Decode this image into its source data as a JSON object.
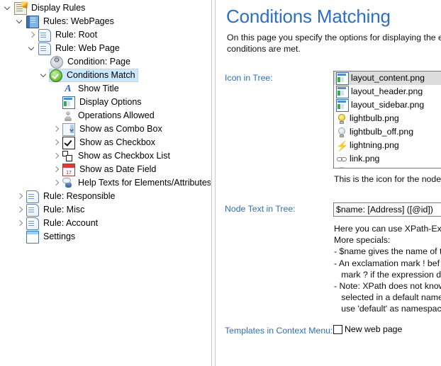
{
  "tree": {
    "items": [
      {
        "label": "Display Rules",
        "depth": 0,
        "expander": "expanded",
        "icon": "document-pencil-icon",
        "icon_class": "ic-displayrules",
        "selected": false
      },
      {
        "label": "Rules: WebPages",
        "depth": 1,
        "expander": "expanded",
        "icon": "book-icon",
        "icon_class": "ic-book",
        "selected": false
      },
      {
        "label": "Rule: Root",
        "depth": 2,
        "expander": "collapsed",
        "icon": "scroll-icon",
        "icon_class": "ic-scroll",
        "selected": false
      },
      {
        "label": "Rule: Web Page",
        "depth": 2,
        "expander": "expanded",
        "icon": "scroll-icon",
        "icon_class": "ic-scroll",
        "selected": false
      },
      {
        "label": "Condition: Page",
        "depth": 3,
        "expander": "none",
        "icon": "condition-gear-icon",
        "icon_class": "ic-condition",
        "selected": false
      },
      {
        "label": "Conditions Match",
        "depth": 3,
        "expander": "expanded",
        "icon": "green-check-circle-icon",
        "icon_class": "ic-check-green",
        "selected": true
      },
      {
        "label": "Show Title",
        "depth": 4,
        "expander": "none",
        "icon": "letter-a-icon",
        "icon_class": "ic-title",
        "selected": false
      },
      {
        "label": "Display Options",
        "depth": 4,
        "expander": "none",
        "icon": "layout-icon",
        "icon_class": "ic-layout",
        "selected": false
      },
      {
        "label": "Operations Allowed",
        "depth": 4,
        "expander": "none",
        "icon": "user-icon",
        "icon_class": "ic-user",
        "selected": false
      },
      {
        "label": "Show as Combo Box",
        "depth": 4,
        "expander": "collapsed",
        "icon": "combobox-icon",
        "icon_class": "ic-combo",
        "selected": false
      },
      {
        "label": "Show as Checkbox",
        "depth": 4,
        "expander": "collapsed",
        "icon": "checkbox-icon",
        "icon_class": "ic-checkbox",
        "selected": false
      },
      {
        "label": "Show as Checkbox List",
        "depth": 4,
        "expander": "collapsed",
        "icon": "checkbox-list-icon",
        "icon_class": "ic-checklist",
        "selected": false
      },
      {
        "label": "Show as Date Field",
        "depth": 4,
        "expander": "collapsed",
        "icon": "calendar-icon",
        "icon_class": "ic-date",
        "selected": false
      },
      {
        "label": "Help Texts for Elements/Attributes",
        "depth": 4,
        "expander": "collapsed",
        "icon": "help-person-icon",
        "icon_class": "ic-help",
        "selected": false
      },
      {
        "label": "Rule: Responsible",
        "depth": 1,
        "expander": "collapsed",
        "icon": "scroll-icon",
        "icon_class": "ic-scroll",
        "selected": false
      },
      {
        "label": "Rule: Misc",
        "depth": 1,
        "expander": "collapsed",
        "icon": "scroll-icon",
        "icon_class": "ic-scroll",
        "selected": false
      },
      {
        "label": "Rule: Account",
        "depth": 1,
        "expander": "collapsed",
        "icon": "scroll-icon",
        "icon_class": "ic-scroll",
        "selected": false
      },
      {
        "label": "Settings",
        "depth": 1,
        "expander": "none",
        "icon": "settings-window-icon",
        "icon_class": "ic-settings",
        "selected": false
      }
    ]
  },
  "panel": {
    "title": "Conditions Matching",
    "description_line1": "On this page you specify the options for displaying the e",
    "description_line2": "conditions are met.",
    "labels": {
      "icon_in_tree": "Icon in Tree:",
      "node_text_in_tree": "Node Text in Tree:",
      "templates_in_context_menu": "Templates in Context Menu:"
    },
    "icon_list": {
      "items": [
        {
          "label": "layout_content.png",
          "icon": "layout-content-icon",
          "icon_class": "ic-layout",
          "selected": true
        },
        {
          "label": "layout_header.png",
          "icon": "layout-header-icon",
          "icon_class": "ic-layout",
          "selected": false
        },
        {
          "label": "layout_sidebar.png",
          "icon": "layout-sidebar-icon",
          "icon_class": "ic-layout",
          "selected": false
        },
        {
          "label": "lightbulb.png",
          "icon": "lightbulb-icon",
          "icon_class": "ic-bulb-on",
          "selected": false
        },
        {
          "label": "lightbulb_off.png",
          "icon": "lightbulb-off-icon",
          "icon_class": "ic-bulb-off",
          "selected": false
        },
        {
          "label": "lightning.png",
          "icon": "lightning-icon",
          "icon_class": "ic-lightning",
          "selected": false
        },
        {
          "label": "link.png",
          "icon": "link-icon",
          "icon_class": "ic-link",
          "selected": false
        },
        {
          "label": "",
          "icon": "partial-row-icon",
          "icon_class": "ic-partial",
          "selected": false
        }
      ],
      "hint": "This is the icon for the node"
    },
    "node_text": {
      "value": "$name: [Address] ([@id])",
      "help": "Here you can use XPath-Exp\nMore specials:\n- $name gives the name of t\n- An exclamation mark ! bef\n   mark ? if the expression do\n- Note: XPath does not know\n   selected in a default names\n   use 'default' as namespace"
    },
    "templates": {
      "checkbox_label": "New web page",
      "checked": false
    }
  },
  "colors": {
    "title_blue": "#2d6fc0",
    "label_blue": "#2f6fb8",
    "tree_selection": "#cce8ff",
    "list_selection": "#dcdcdc"
  }
}
